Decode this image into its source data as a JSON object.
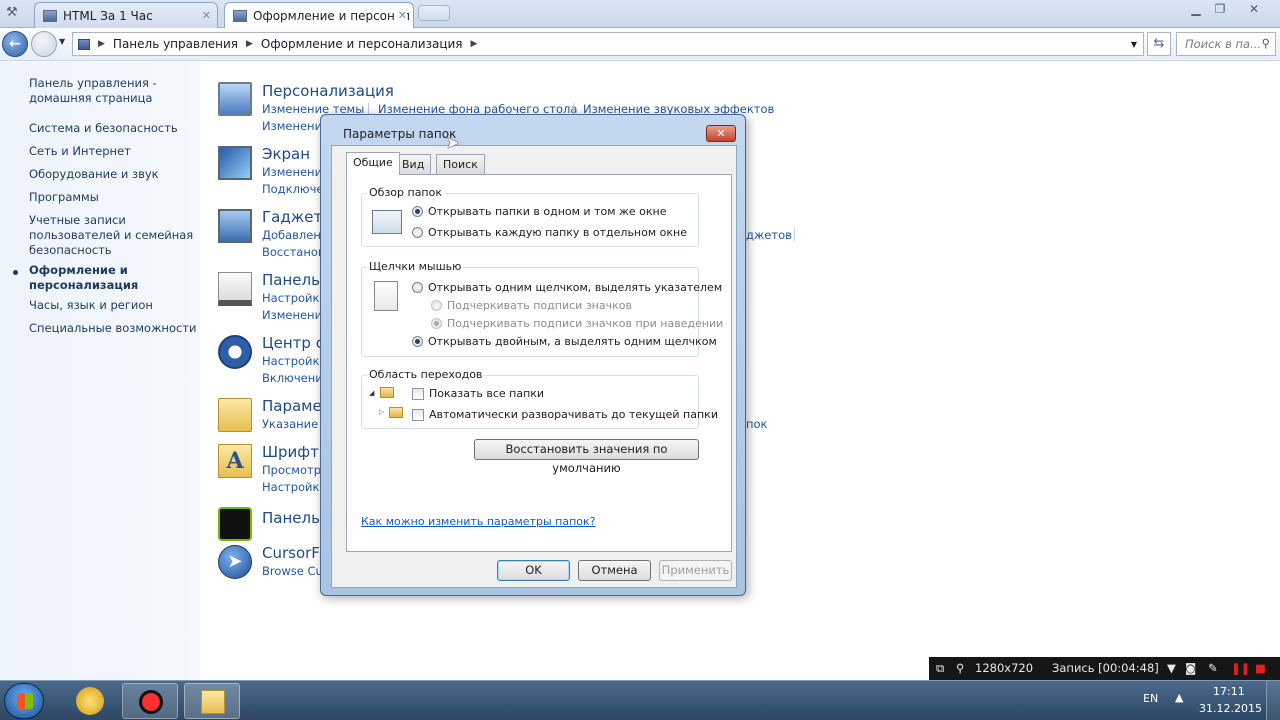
{
  "browser": {
    "tabs": [
      {
        "label": "HTML За 1 Час",
        "active": false
      },
      {
        "label": "Оформление и персонал",
        "active": true
      }
    ],
    "address": {
      "crumbs": [
        "Панель управления",
        "Оформление и персонализация"
      ],
      "search_placeholder": "Поиск в па..."
    }
  },
  "sidebar": {
    "items": [
      {
        "label": "Панель управления -"
      },
      {
        "label": "домашняя страница"
      },
      {
        "label": "Система и безопасность"
      },
      {
        "label": "Сеть и Интернет"
      },
      {
        "label": "Оборудование и звук"
      },
      {
        "label": "Программы"
      },
      {
        "label": "Учетные записи"
      },
      {
        "label": "пользователей и семейная"
      },
      {
        "label": "безопасность"
      },
      {
        "label": "Оформление и"
      },
      {
        "label": "персонализация"
      },
      {
        "label": "Часы, язык и регион"
      },
      {
        "label": "Специальные возможности"
      }
    ]
  },
  "main": {
    "categories": [
      {
        "title": "Персонализация",
        "link1": "Изменение темы",
        "link2": "Изменени",
        "extra1": "Изменение фона рабочего стола",
        "extra2": "Изменение звуковых эффектов"
      },
      {
        "title": "Экран",
        "link1": "Изменени",
        "link2": "Подключе"
      },
      {
        "title": "Гаджеты",
        "link1": "Добавлен",
        "link2": "Восстанов",
        "extra1": "джетов"
      },
      {
        "title": "Панель",
        "link1": "Настройка",
        "link2": "Изменени"
      },
      {
        "title": "Центр с",
        "link1": "Настройка",
        "link2": "Включени"
      },
      {
        "title": "Парамет",
        "link1": "Указание",
        "extra1": "пок"
      },
      {
        "title": "Шрифты",
        "link1": "Просмотр",
        "link2": "Настройка"
      },
      {
        "title": "Панель"
      },
      {
        "title": "CursorF",
        "link1": "Browse Cu"
      }
    ]
  },
  "dialog": {
    "title": "Параметры папок",
    "tabs": [
      "Общие",
      "Вид",
      "Поиск"
    ],
    "browse_group": {
      "label": "Обзор папок",
      "opt1": "Открывать папки в одном и том же окне",
      "opt2": "Открывать каждую папку в отдельном окне"
    },
    "click_group": {
      "label": "Щелчки мышью",
      "opt1": "Открывать одним щелчком, выделять указателем",
      "sub1": "Подчеркивать подписи значков",
      "sub2": "Подчеркивать подписи значков при наведении",
      "opt2": "Открывать двойным, а выделять одним щелчком"
    },
    "nav_group": {
      "label": "Область переходов",
      "opt1": "Показать все папки",
      "opt2": "Автоматически разворачивать до текущей папки"
    },
    "restore_button": "Восстановить значения по умолчанию",
    "help_link": "Как можно изменить параметры папок?",
    "ok": "OK",
    "cancel": "Отмена",
    "apply": "Применить"
  },
  "recorder": {
    "resolution": "1280x720",
    "status": "Запись [00:04:48]"
  },
  "taskbar": {
    "lang": "EN",
    "time": "17:11",
    "date": "31.12.2015"
  }
}
